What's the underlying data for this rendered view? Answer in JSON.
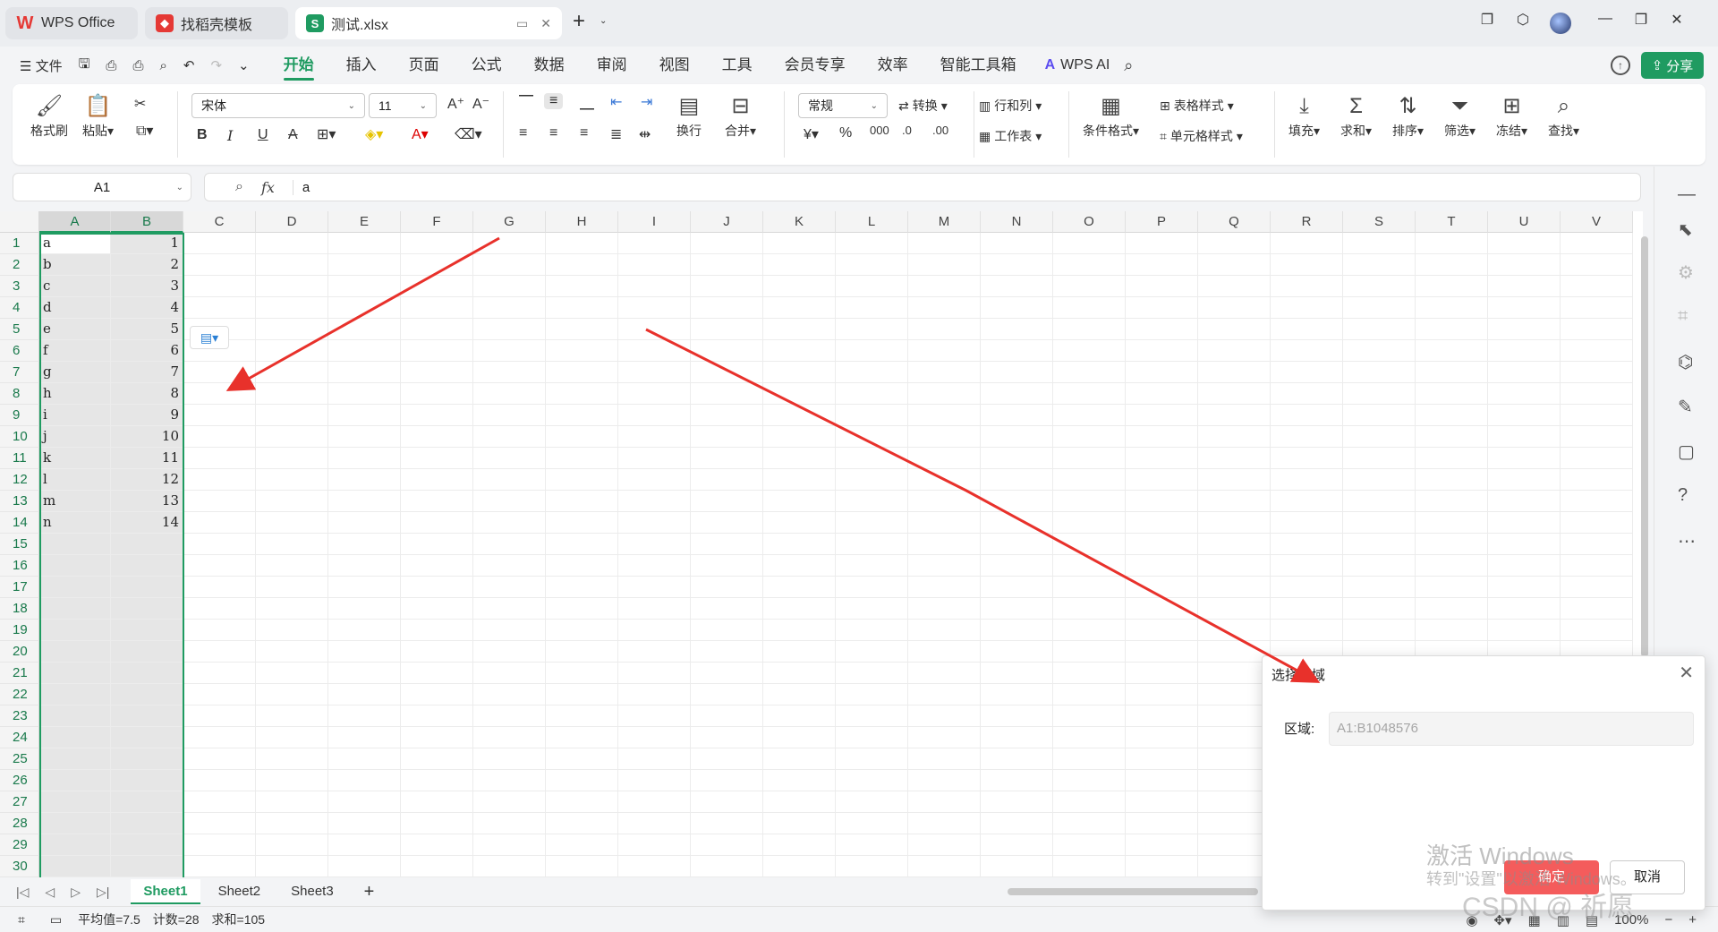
{
  "titlebar": {
    "tabs": [
      {
        "label": "WPS Office"
      },
      {
        "label": "找稻壳模板"
      },
      {
        "label": "测试.xlsx"
      }
    ]
  },
  "menu": {
    "file": "文件",
    "tabs": [
      "开始",
      "插入",
      "页面",
      "公式",
      "数据",
      "审阅",
      "视图",
      "工具",
      "会员专享",
      "效率",
      "智能工具箱"
    ],
    "active_tab": "开始",
    "wps_ai": "WPS AI",
    "share": "分享"
  },
  "ribbon": {
    "format_painter": "格式刷",
    "paste": "粘贴",
    "font_name": "宋体",
    "font_size": "11",
    "wrap": "换行",
    "merge": "合并",
    "number_format": "常规",
    "convert": "转换",
    "row_col": "行和列",
    "worksheet": "工作表",
    "cond_format": "条件格式",
    "table_style": "表格样式",
    "cell_style": "单元格样式",
    "fill": "填充",
    "sum": "求和",
    "sort": "排序",
    "filter": "筛选",
    "freeze": "冻结",
    "find": "查找"
  },
  "formula": {
    "name_box": "A1",
    "fx": "fx",
    "value": "a"
  },
  "grid": {
    "columns": [
      "A",
      "B",
      "C",
      "D",
      "E",
      "F",
      "G",
      "H",
      "I",
      "J",
      "K",
      "L",
      "M",
      "N",
      "O",
      "P",
      "Q",
      "R",
      "S",
      "T",
      "U",
      "V"
    ],
    "rows": [
      "1",
      "2",
      "3",
      "4",
      "5",
      "6",
      "7",
      "8",
      "9",
      "10",
      "11",
      "12",
      "13",
      "14",
      "15",
      "16",
      "17",
      "18",
      "19",
      "20",
      "21",
      "22",
      "23",
      "24",
      "25",
      "26",
      "27",
      "28",
      "29",
      "30"
    ],
    "data": [
      [
        "a",
        "1"
      ],
      [
        "b",
        "2"
      ],
      [
        "c",
        "3"
      ],
      [
        "d",
        "4"
      ],
      [
        "e",
        "5"
      ],
      [
        "f",
        "6"
      ],
      [
        "g",
        "7"
      ],
      [
        "h",
        "8"
      ],
      [
        "i",
        "9"
      ],
      [
        "j",
        "10"
      ],
      [
        "k",
        "11"
      ],
      [
        "l",
        "12"
      ],
      [
        "m",
        "13"
      ],
      [
        "n",
        "14"
      ]
    ]
  },
  "sheets": {
    "tabs": [
      "Sheet1",
      "Sheet2",
      "Sheet3"
    ],
    "active": "Sheet1"
  },
  "status": {
    "average": "平均值=7.5",
    "count": "计数=28",
    "sum": "求和=105",
    "zoom": "100%"
  },
  "dialog": {
    "title": "选择区域",
    "label": "区域:",
    "range_value": "A1:B1048576",
    "ok": "确定",
    "cancel": "取消"
  },
  "watermark": {
    "line1": "激活 Windows",
    "line2": "转到\"设置\"以激活 Windows。",
    "line3": "CSDN @    祈愿"
  },
  "colors": {
    "accent": "#1f9b61",
    "arrow": "#e8312b",
    "ok_button": "#f45c5c"
  }
}
